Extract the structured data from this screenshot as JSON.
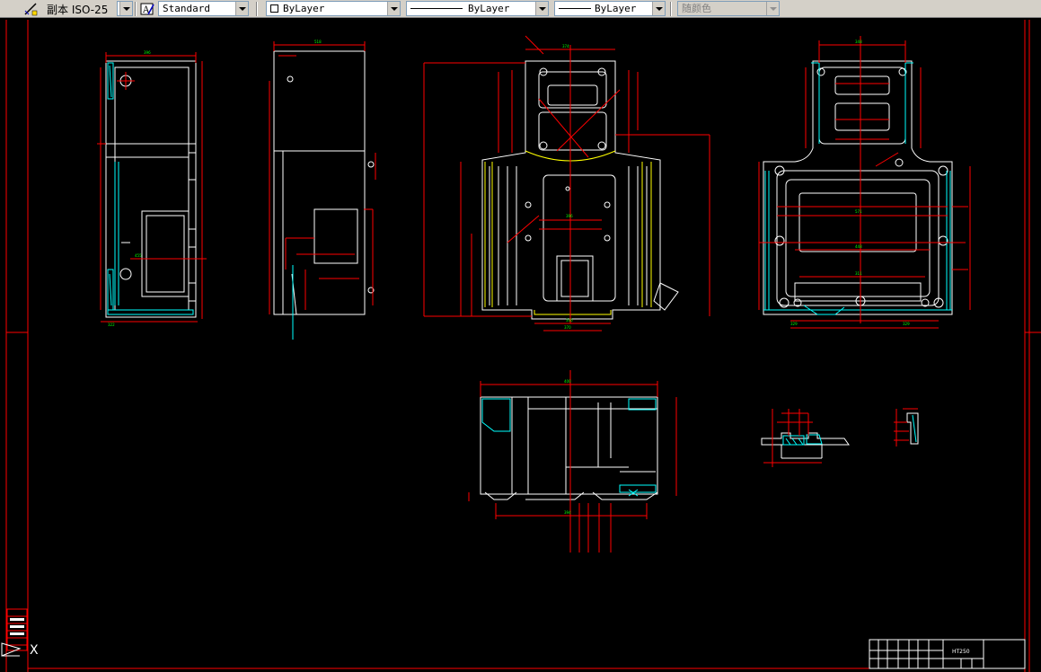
{
  "toolbar": {
    "dimstyle_label": "副本 ISO-25",
    "textstyle_value": "Standard",
    "color_value": "ByLayer",
    "linetype_value": "ByLayer",
    "lineweight_value": "ByLayer",
    "plotstyle_value": "随颜色",
    "icons": [
      "dimension-style-icon",
      "text-style-icon",
      "color-swatch-icon"
    ]
  },
  "title_block": {
    "material": "HT250"
  },
  "colors": {
    "background": "#000000",
    "geometry": "#ffffff",
    "dimension": "#ff0000",
    "dimension_text": "#00ff00",
    "hatch": "#00ffff",
    "border": "#ff0000"
  },
  "ucs": {
    "x_label": "X"
  }
}
